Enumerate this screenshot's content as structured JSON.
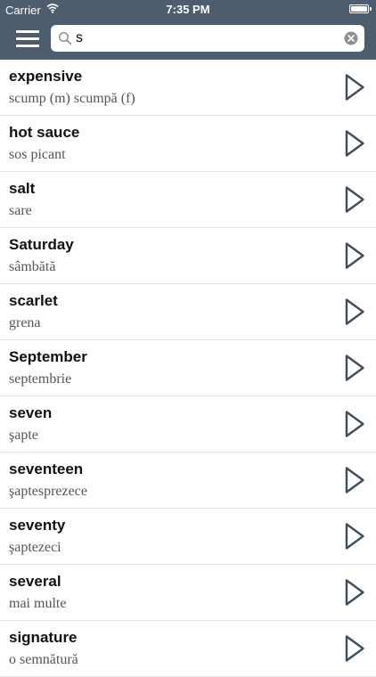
{
  "status_bar": {
    "carrier": "Carrier",
    "time": "7:35 PM"
  },
  "search": {
    "value": "s",
    "icon": "search-icon",
    "clear_icon": "clear-icon"
  },
  "menu_icon": "hamburger-menu-icon",
  "play_icon": "play-icon",
  "colors": {
    "header": "#4d5d6e",
    "term": "#111111",
    "translation": "#555555",
    "play_icon": "#3f4c5c"
  },
  "entries": [
    {
      "term": "expensive",
      "translation": "scump (m)  scumpă (f)"
    },
    {
      "term": "hot sauce",
      "translation": "sos picant"
    },
    {
      "term": "salt",
      "translation": "sare"
    },
    {
      "term": "Saturday",
      "translation": "sâmbătă"
    },
    {
      "term": "scarlet",
      "translation": "grena"
    },
    {
      "term": "September",
      "translation": "septembrie"
    },
    {
      "term": "seven",
      "translation": "şapte"
    },
    {
      "term": "seventeen",
      "translation": "şaptesprezece"
    },
    {
      "term": "seventy",
      "translation": "şaptezeci"
    },
    {
      "term": "several",
      "translation": "mai multe"
    },
    {
      "term": "signature",
      "translation": "o semnătură"
    }
  ]
}
